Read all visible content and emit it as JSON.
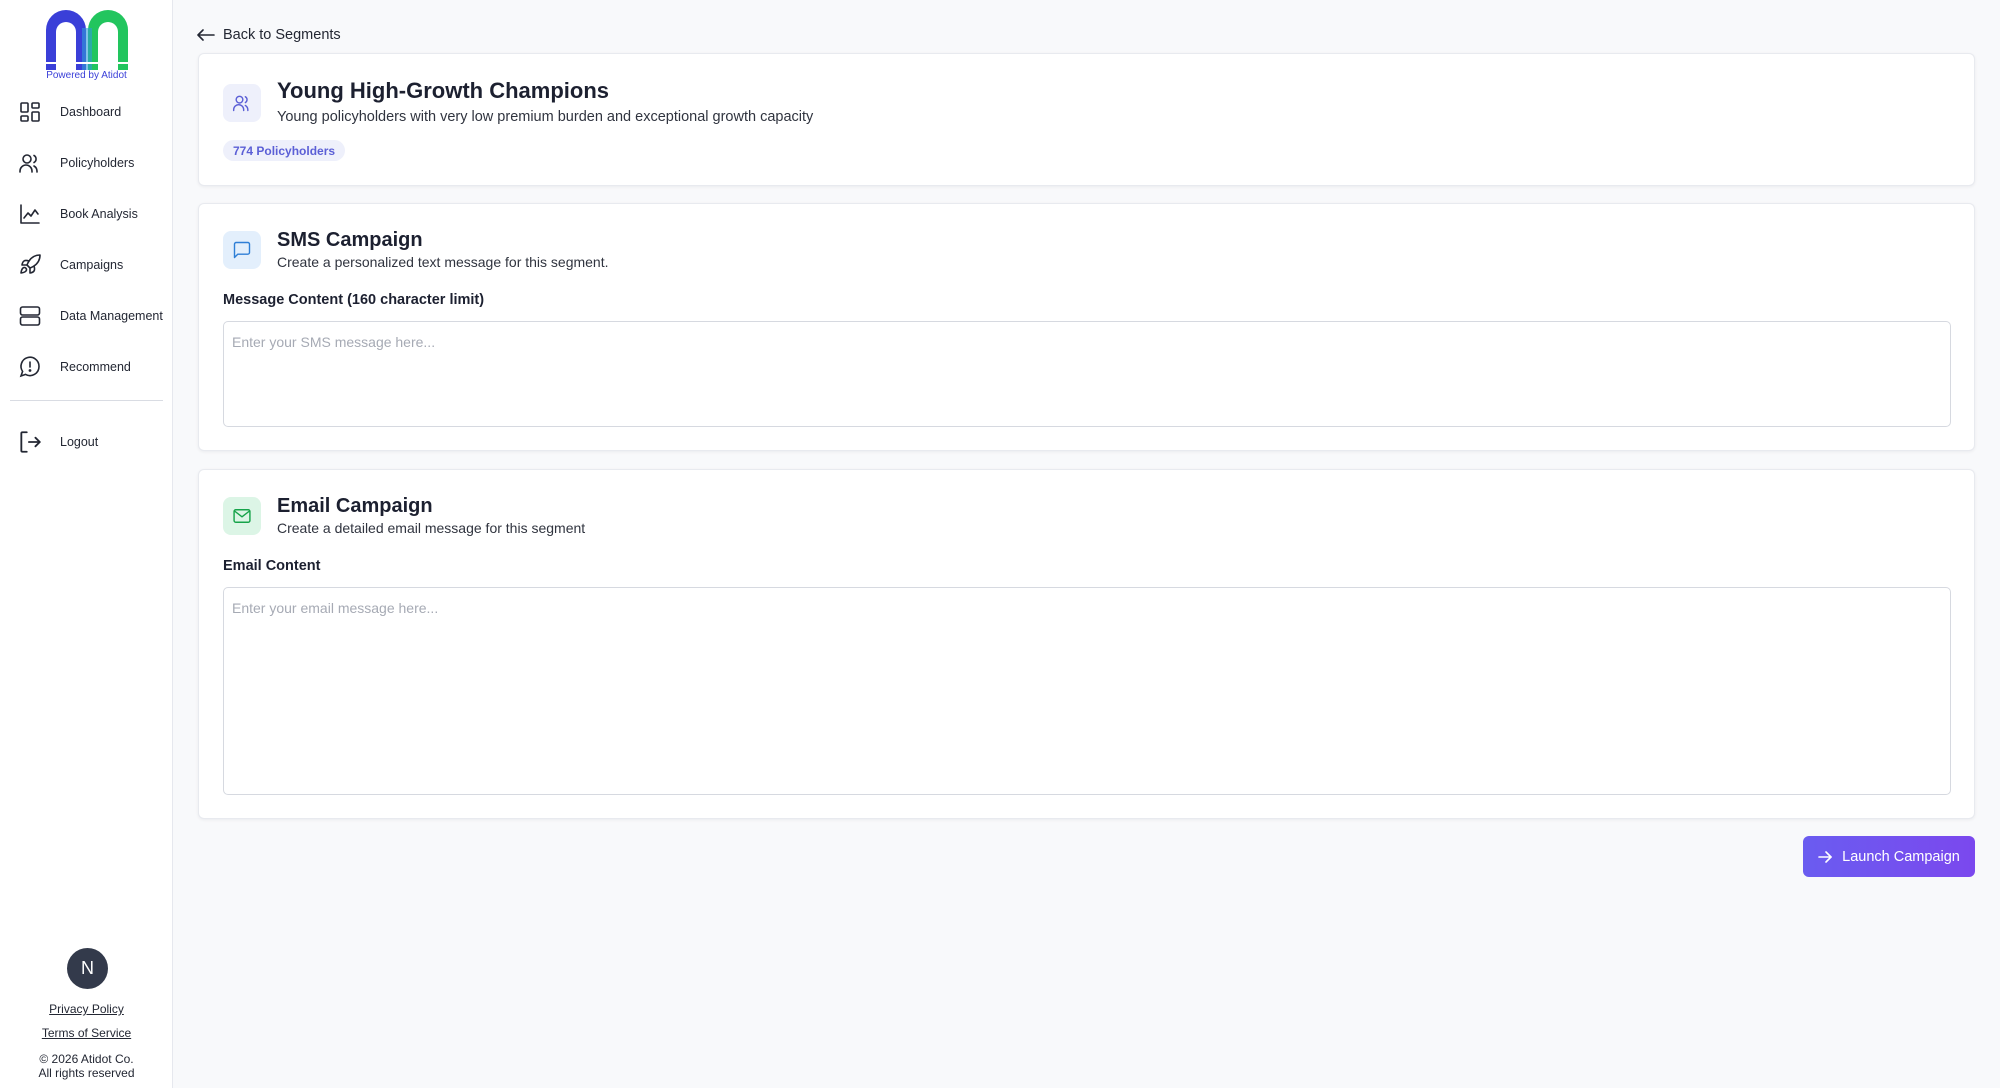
{
  "brand": {
    "caption": "Powered by Atidot",
    "colors": {
      "blue": "#3a3fd8",
      "green": "#22c55e"
    }
  },
  "sidebar": {
    "items": [
      {
        "label": "Dashboard",
        "icon": "dashboard-grid-icon"
      },
      {
        "label": "Policyholders",
        "icon": "users-icon"
      },
      {
        "label": "Book Analysis",
        "icon": "line-chart-icon"
      },
      {
        "label": "Campaigns",
        "icon": "rocket-icon"
      },
      {
        "label": "Data Management",
        "icon": "server-icon"
      },
      {
        "label": "Recommend",
        "icon": "alert-message-icon"
      }
    ],
    "logout": {
      "label": "Logout",
      "icon": "logout-icon"
    },
    "avatar_initial": "N",
    "privacy": "Privacy Policy",
    "terms": "Terms of Service",
    "copyright": "© 2026 Atidot Co.",
    "rights": "All rights reserved"
  },
  "main": {
    "back_label": "Back to Segments",
    "segment": {
      "title": "Young High-Growth Champions",
      "description": "Young policyholders with very low premium burden and exceptional growth capacity",
      "badge": "774 Policyholders"
    },
    "sms": {
      "title": "SMS Campaign",
      "subtitle": "Create a personalized text message for this segment.",
      "field_label": "Message Content (160 character limit)",
      "placeholder": "Enter your SMS message here...",
      "value": ""
    },
    "email": {
      "title": "Email Campaign",
      "subtitle": "Create a detailed email message for this segment",
      "field_label": "Email Content",
      "placeholder": "Enter your email message here...",
      "value": ""
    },
    "launch_label": "Launch Campaign"
  },
  "colors": {
    "accent": "#6a5cf0",
    "sms_tile": "#e3effc",
    "email_tile": "#dcf5e6",
    "segment_tile": "#eef0fb"
  }
}
